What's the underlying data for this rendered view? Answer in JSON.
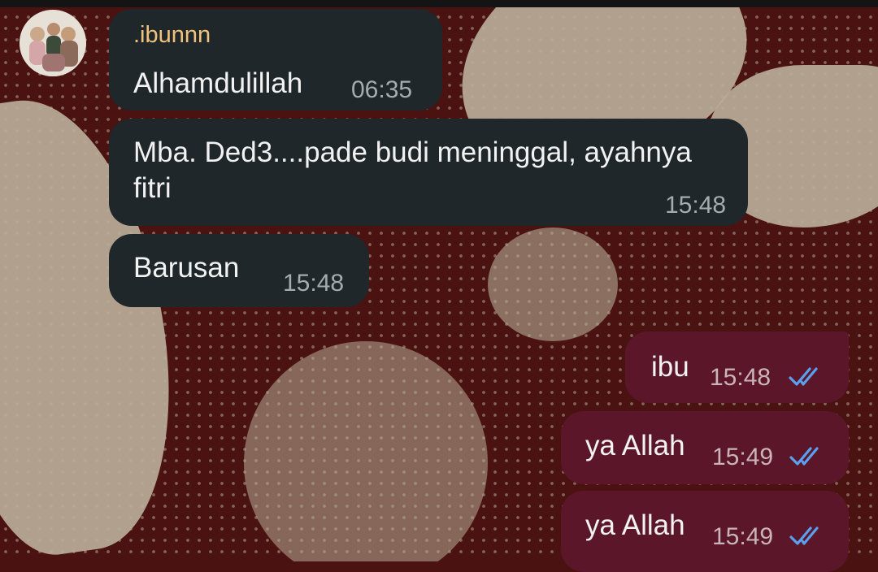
{
  "chat": {
    "messages": [
      {
        "sender": ".ibunnn",
        "text": "Alhamdulillah",
        "time": "06:35",
        "direction": "incoming"
      },
      {
        "text": "Mba. Ded3....pade budi meninggal, ayahnya fitri",
        "time": "15:48",
        "direction": "incoming"
      },
      {
        "text": "Barusan",
        "time": "15:48",
        "direction": "incoming"
      },
      {
        "text": "ibu",
        "time": "15:48",
        "direction": "outgoing",
        "status": "read"
      },
      {
        "text": "ya Allah",
        "time": "15:49",
        "direction": "outgoing",
        "status": "read"
      },
      {
        "text": "ya Allah",
        "time": "15:49",
        "direction": "outgoing",
        "status": "read"
      }
    ]
  },
  "colors": {
    "incoming_bubble": "#1f272a",
    "outgoing_bubble": "#5b1729",
    "sender_name": "#f1c27a",
    "read_ticks": "#5aa0f0"
  },
  "icons": {
    "read_status": "double-check-icon",
    "avatar": "profile-photo"
  }
}
